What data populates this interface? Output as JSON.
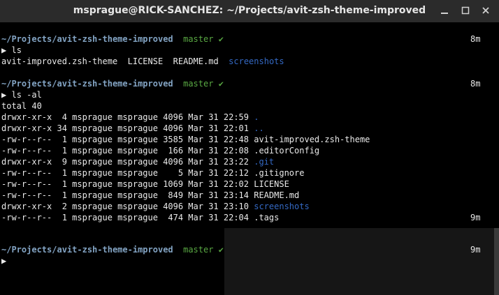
{
  "window": {
    "title": "msprague@RICK-SANCHEZ: ~/Projects/avit-zsh-theme-improved"
  },
  "prompt": {
    "path": "~/Projects/avit-zsh-theme-improved",
    "branch": "master",
    "check": "✔",
    "arrow": "▶"
  },
  "blocks": [
    {
      "cmd": "ls",
      "elapsed": "8m"
    },
    {
      "cmd": "ls -al",
      "elapsed": "8m"
    },
    {
      "cmd": "",
      "elapsed": "9m"
    }
  ],
  "ls_output": {
    "files": [
      "avit-improved.zsh-theme",
      "LICENSE",
      "README.md"
    ],
    "dir": "screenshots"
  },
  "ls_al": {
    "total": "total 40",
    "rows": [
      {
        "meta": "drwxr-xr-x  4 msprague msprague 4096 Mar 31 22:59 ",
        "name": ".",
        "is_dir": true
      },
      {
        "meta": "drwxr-xr-x 34 msprague msprague 4096 Mar 31 22:01 ",
        "name": "..",
        "is_dir": true
      },
      {
        "meta": "-rw-r--r--  1 msprague msprague 3585 Mar 31 22:48 ",
        "name": "avit-improved.zsh-theme",
        "is_dir": false
      },
      {
        "meta": "-rw-r--r--  1 msprague msprague  166 Mar 31 22:08 ",
        "name": ".editorConfig",
        "is_dir": false
      },
      {
        "meta": "drwxr-xr-x  9 msprague msprague 4096 Mar 31 23:22 ",
        "name": ".git",
        "is_dir": true
      },
      {
        "meta": "-rw-r--r--  1 msprague msprague    5 Mar 31 22:12 ",
        "name": ".gitignore",
        "is_dir": false
      },
      {
        "meta": "-rw-r--r--  1 msprague msprague 1069 Mar 31 22:02 ",
        "name": "LICENSE",
        "is_dir": false
      },
      {
        "meta": "-rw-r--r--  1 msprague msprague  849 Mar 31 23:14 ",
        "name": "README.md",
        "is_dir": false
      },
      {
        "meta": "drwxr-xr-x  2 msprague msprague 4096 Mar 31 23:10 ",
        "name": "screenshots",
        "is_dir": true
      },
      {
        "meta": "-rw-r--r--  1 msprague msprague  474 Mar 31 22:04 ",
        "name": ".tags",
        "is_dir": false
      }
    ],
    "trailing_elapsed": "9m"
  },
  "colors": {
    "path": "#83a4c4",
    "branch": "#59a843",
    "directory": "#3469c4",
    "text": "#e9e9e9",
    "titlebar": "#2b2b2b"
  },
  "icons": {
    "minimize": "minimize-icon",
    "maximize": "maximize-icon",
    "close": "close-icon"
  }
}
